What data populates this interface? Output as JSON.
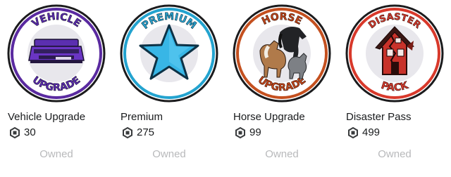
{
  "passes": [
    {
      "name": "Vehicle Upgrade",
      "price": "30",
      "status": "Owned",
      "badge_top": "VEHICLE",
      "badge_bottom": "UPGRADE",
      "icon": "purple-car-icon",
      "ring_color": "#6b2fb3"
    },
    {
      "name": "Premium",
      "price": "275",
      "status": "Owned",
      "badge_top": "PREMIUM",
      "badge_bottom": "",
      "icon": "blue-star-icon",
      "ring_color": "#26a6cf"
    },
    {
      "name": "Horse Upgrade",
      "price": "99",
      "status": "Owned",
      "badge_top": "HORSE",
      "badge_bottom": "UPGRADE",
      "icon": "horses-icon",
      "ring_color": "#c0471d"
    },
    {
      "name": "Disaster Pass",
      "price": "499",
      "status": "Owned",
      "badge_top": "DISASTER",
      "badge_bottom": "PACK",
      "icon": "broken-house-icon",
      "ring_color": "#d83a2d"
    }
  ],
  "currency_icon": "robux-icon"
}
